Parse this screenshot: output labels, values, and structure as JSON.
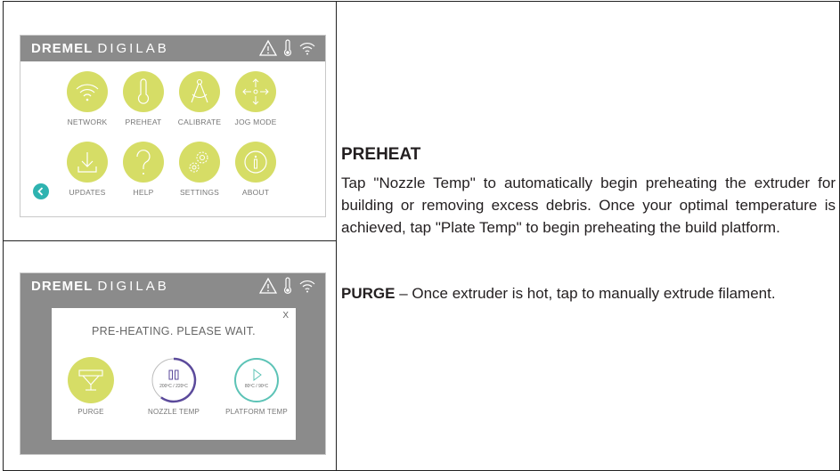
{
  "brand": {
    "bold": "DREMEL",
    "thin": "DIGILAB"
  },
  "menu": {
    "tiles": [
      {
        "label": "NETWORK",
        "icon": "wifi-icon"
      },
      {
        "label": "PREHEAT",
        "icon": "thermometer-icon"
      },
      {
        "label": "CALIBRATE",
        "icon": "compass-icon"
      },
      {
        "label": "JOG MODE",
        "icon": "move-arrows-icon"
      },
      {
        "label": "UPDATES",
        "icon": "download-icon"
      },
      {
        "label": "HELP",
        "icon": "question-icon"
      },
      {
        "label": "SETTINGS",
        "icon": "gears-icon"
      },
      {
        "label": "ABOUT",
        "icon": "info-icon"
      }
    ]
  },
  "dialog": {
    "close": "X",
    "title": "PRE-HEATING. PLEASE WAIT.",
    "purge_label": "PURGE",
    "nozzle": {
      "label": "NOZZLE TEMP",
      "reading": "200ºC / 220ºC",
      "progress": 0.6
    },
    "platform": {
      "label": "PLATFORM TEMP",
      "reading": "80ºC / 90ºC",
      "progress": 1.0
    }
  },
  "text": {
    "heading": "PREHEAT",
    "para1": "Tap \"Nozzle Temp\" to automatically begin preheating the extruder for building or removing excess debris. Once your optimal temperature is achieved, tap \"Plate Temp\" to begin preheating the build platform.",
    "para2_lead": "PURGE",
    "para2_rest": " – Once extruder is hot, tap to manually extrude filament."
  },
  "colors": {
    "tile": "#d6dd66",
    "topbar": "#8b8b8b",
    "accent_teal": "#2eb3b0",
    "ring_progress": "#5b4a9b",
    "ring_teal": "#5cc3b6"
  }
}
